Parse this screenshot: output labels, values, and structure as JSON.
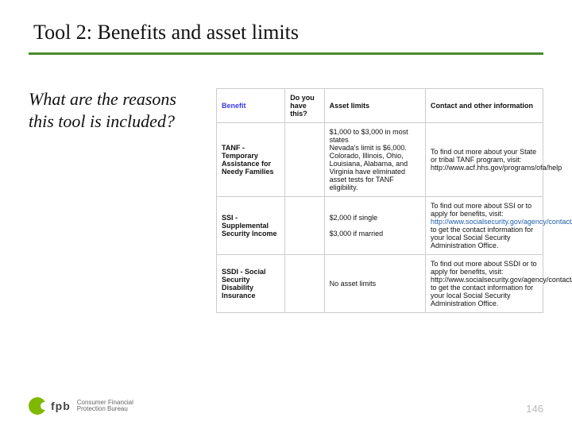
{
  "title": "Tool 2: Benefits and asset limits",
  "question": "What are the reasons this tool is included?",
  "table": {
    "headers": {
      "benefit": "Benefit",
      "doyou": "Do you have this?",
      "asset": "Asset limits",
      "contact": "Contact and other information"
    },
    "rows": [
      {
        "label": "TANF - Temporary Assistance for Needy Families",
        "asset": "$1,000 to $3,000 in most states\nNevada's limit is $6,000. Colorado, Illinois, Ohio, Louisiana, Alabama, and Virginia have eliminated asset tests for TANF eligibility.",
        "contact": "To find out more about your State or tribal TANF program, visit: http://www.acf.hhs.gov/programs/ofa/help"
      },
      {
        "label": "SSI - Supplemental Security Income",
        "asset": "$2,000 if single\n\n$3,000 if married",
        "contact_pre": "To find out more about SSI or to apply for benefits, visit: ",
        "contact_link": "http://www.socialsecurity.gov/agency/contact/",
        "contact_post": " to get the contact information for your local Social Security Administration Office."
      },
      {
        "label": "SSDI - Social Security Disability Insurance",
        "asset": "No asset limits",
        "contact": "To find out more about SSDI or to apply for benefits, visit: http://www.socialsecurity.gov/agency/contact/ to get the contact information for your local Social Security Administration Office."
      }
    ]
  },
  "footer": {
    "logo_letters": "fpb",
    "org_line1": "Consumer Financial",
    "org_line2": "Protection Bureau",
    "page": "146"
  }
}
